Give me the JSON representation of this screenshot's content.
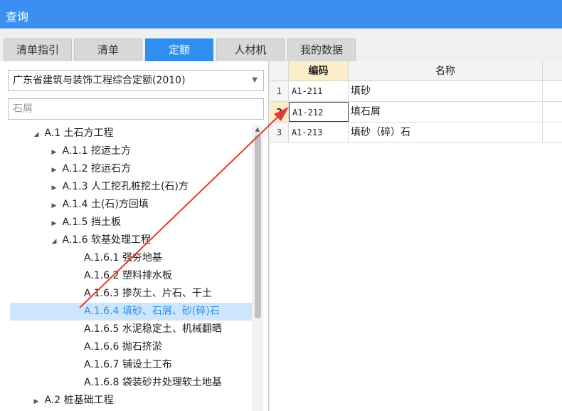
{
  "window": {
    "title": "查询"
  },
  "tabs": [
    {
      "label": "清单指引",
      "active": false
    },
    {
      "label": "清单",
      "active": false
    },
    {
      "label": "定额",
      "active": true
    },
    {
      "label": "人材机",
      "active": false
    },
    {
      "label": "我的数据",
      "active": false
    }
  ],
  "quota_library": {
    "selected": "广东省建筑与装饰工程综合定额(2010)"
  },
  "search": {
    "value": "石屑"
  },
  "tree": [
    {
      "label": "A.1 土石方工程",
      "level": 0,
      "expanded": true
    },
    {
      "label": "A.1.1 挖运土方",
      "level": 1,
      "expanded": false
    },
    {
      "label": "A.1.2 挖运石方",
      "level": 1,
      "expanded": false
    },
    {
      "label": "A.1.3 人工挖孔桩挖土(石)方",
      "level": 1,
      "expanded": false
    },
    {
      "label": "A.1.4 土(石)方回填",
      "level": 1,
      "expanded": false
    },
    {
      "label": "A.1.5 挡土板",
      "level": 1,
      "expanded": false
    },
    {
      "label": "A.1.6 软基处理工程",
      "level": 1,
      "expanded": true
    },
    {
      "label": "A.1.6.1 强夯地基",
      "level": 2
    },
    {
      "label": "A.1.6.2 塑料排水板",
      "level": 2
    },
    {
      "label": "A.1.6.3 掺灰土、片石、干土",
      "level": 2
    },
    {
      "label": "A.1.6.4 填砂、石屑、砂(碎)石",
      "level": 2,
      "selected": true
    },
    {
      "label": "A.1.6.5 水泥稳定土、机械翻晒",
      "level": 2
    },
    {
      "label": "A.1.6.6 抛石挤淤",
      "level": 2
    },
    {
      "label": "A.1.6.7 铺设土工布",
      "level": 2
    },
    {
      "label": "A.1.6.8 袋装砂井处理软土地基",
      "level": 2
    },
    {
      "label": "A.2 桩基础工程",
      "level": 0,
      "expanded": false
    }
  ],
  "results": {
    "columns": {
      "code": "编码",
      "name": "名称"
    },
    "rows": [
      {
        "num": "1",
        "code": "A1-211",
        "name": "填砂"
      },
      {
        "num": "2",
        "code": "A1-212",
        "name": "填石屑",
        "current": true
      },
      {
        "num": "3",
        "code": "A1-213",
        "name": "填砂（碎）石"
      }
    ]
  },
  "colors": {
    "titlebar": "#3a8ff0",
    "active_tab": "#2f8ff0",
    "annotation_arrow": "#e53935"
  }
}
